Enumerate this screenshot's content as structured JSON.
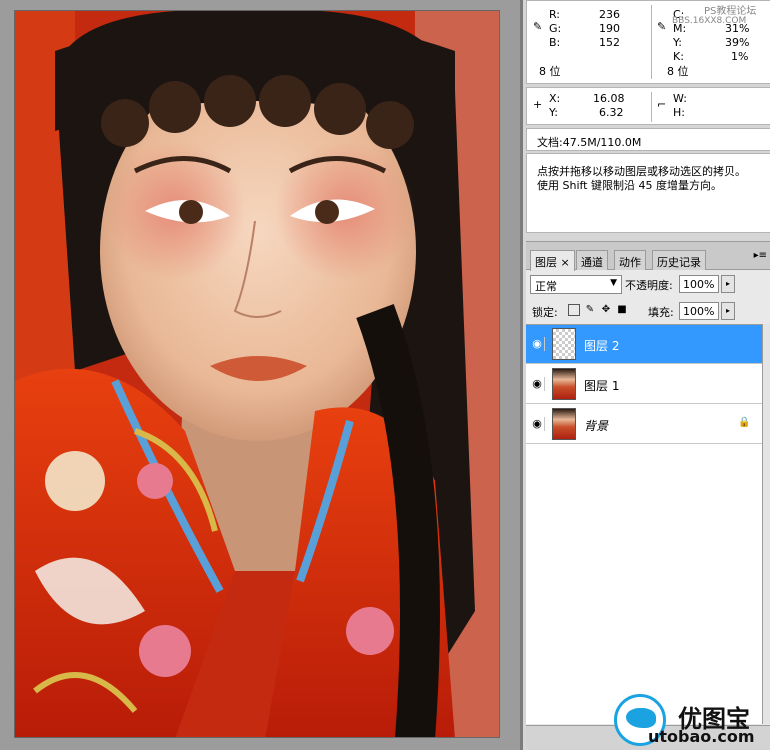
{
  "info": {
    "rgb": {
      "r_label": "R:",
      "r": "236",
      "g_label": "G:",
      "g": "190",
      "b_label": "B:",
      "b": "152",
      "bit": "8 位"
    },
    "cmyk": {
      "c_label": "C:",
      "c": "",
      "m_label": "M:",
      "m": "31%",
      "y_label": "Y:",
      "y": "39%",
      "k_label": "K:",
      "k": "1%",
      "bit": "8 位"
    },
    "xy": {
      "x_label": "X:",
      "x": "16.08",
      "y_label": "Y:",
      "y": "6.32"
    },
    "wh": {
      "w_label": "W:",
      "h_label": "H:"
    },
    "doc": "文档:47.5M/110.0M",
    "hint_line1": "点按并拖移以移动图层或移动选区的拷贝。",
    "hint_line2": "使用 Shift 键限制沿 45 度增量方向。"
  },
  "layers_panel": {
    "tabs": [
      "图层 ×",
      "通道",
      "动作",
      "历史记录"
    ],
    "menu_icon": "▸≡",
    "blend_mode": "正常",
    "opacity_label": "不透明度:",
    "opacity": "100%",
    "lock_label": "锁定:",
    "fill_label": "填充:",
    "fill": "100%",
    "layers": [
      {
        "name": "图层 2",
        "selected": true,
        "thumb": "transparent"
      },
      {
        "name": "图层 1",
        "selected": false,
        "thumb": "image"
      },
      {
        "name": "背景",
        "selected": false,
        "thumb": "image",
        "locked": true
      }
    ]
  },
  "watermark": {
    "top_site": "PS教程论坛",
    "top_url": "BBS.16XX8.COM",
    "logo_cn": "优图宝",
    "logo_url": "utobao.com"
  },
  "colors": {
    "selection": "#3399ff",
    "panel_bg": "#d6d6d6",
    "canvas_bg": "#9c9c9c"
  }
}
